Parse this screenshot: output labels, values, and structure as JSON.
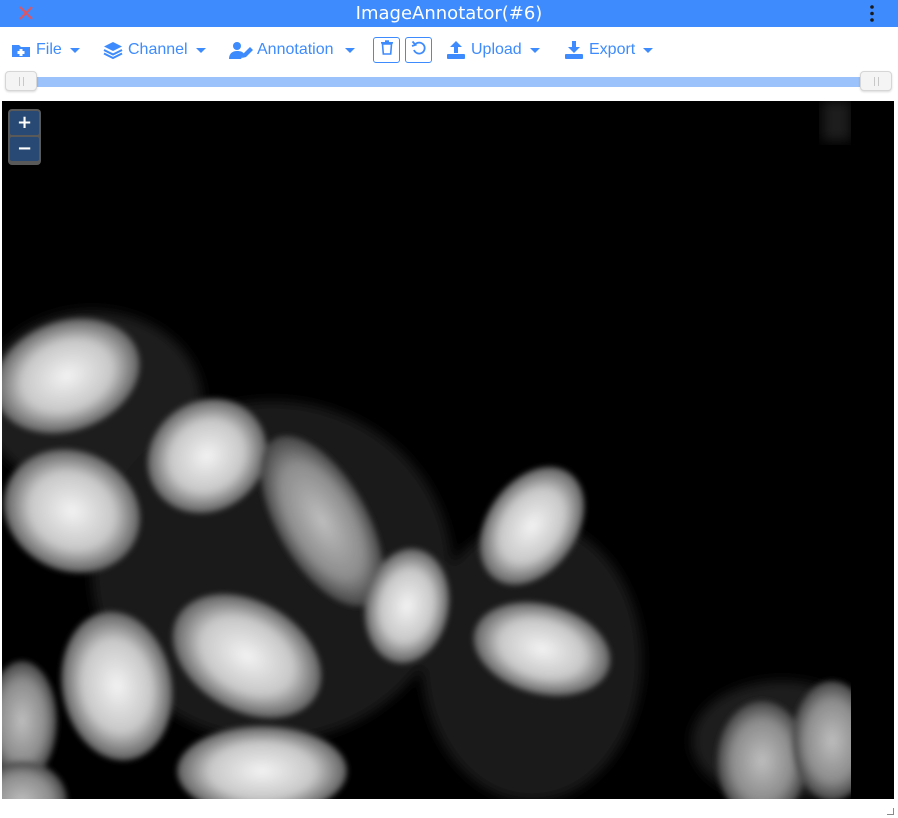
{
  "window": {
    "title": "ImageAnnotator(#6)",
    "close_icon": "close-x-icon",
    "menu_icon": "vertical-dots-icon",
    "accent_color": "#3d8bfd",
    "close_color": "#e05561"
  },
  "toolbar": {
    "file": {
      "label": "File",
      "icon": "folder-plus-icon"
    },
    "channel": {
      "label": "Channel",
      "icon": "layers-icon"
    },
    "annotation": {
      "label": "Annotation",
      "icon": "user-edit-icon"
    },
    "delete_button": {
      "icon": "trash-icon"
    },
    "undo_button": {
      "icon": "undo-icon"
    },
    "upload": {
      "label": "Upload",
      "icon": "upload-icon"
    },
    "export": {
      "label": "Export",
      "icon": "download-icon"
    }
  },
  "range_slider": {
    "min_fraction": 0.0,
    "max_fraction": 1.0,
    "track_color": "#9bc2fb"
  },
  "viewer": {
    "background": "#000000",
    "zoom_in_label": "+",
    "zoom_out_label": "−",
    "image_description_icon": "microscopy-image"
  }
}
